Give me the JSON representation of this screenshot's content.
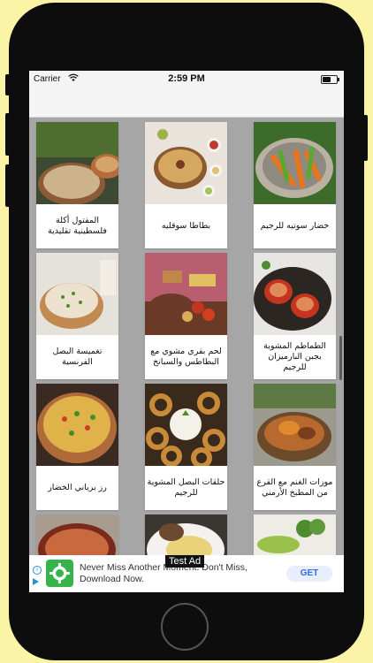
{
  "status_bar": {
    "carrier": "Carrier",
    "time": "2:59 PM"
  },
  "recipes": [
    {
      "title": "خضار سوتيه للرجيم",
      "image": "sauteed-vegetables-photo"
    },
    {
      "title": "بطاطا سوقليه",
      "image": "mashed-potato-dish-photo"
    },
    {
      "title": "المفتول أكلة فلسطينية تقليدية",
      "image": "maftoul-couscous-photo"
    },
    {
      "title": "الطماطم المشوية بجبن البارميزان للرجيم",
      "image": "grilled-tomatoes-pan-photo"
    },
    {
      "title": "لحم بقري مشوي مع البطاطس والسبانخ",
      "image": "roast-beef-potatoes-photo"
    },
    {
      "title": "تغميسة البصل الفرنسية",
      "image": "onion-dip-bowl-photo"
    },
    {
      "title": "موزات الغنم مع القرع من المطبخ الأرمني",
      "image": "lamb-shank-pumpkin-photo"
    },
    {
      "title": "حلقات البصل المشوية للرجيم",
      "image": "onion-rings-photo"
    },
    {
      "title": "رز برياني الخضار",
      "image": "vegetable-biryani-photo"
    },
    {
      "title": "",
      "image": "soup-bowl-photo"
    },
    {
      "title": "",
      "image": "pasta-plate-photo"
    },
    {
      "title": "",
      "image": "baked-dish-photo"
    }
  ],
  "ad": {
    "headline": "Never Miss Another Moment. Don't Miss, Download Now.",
    "cta": "GET",
    "label": "Test Ad"
  }
}
